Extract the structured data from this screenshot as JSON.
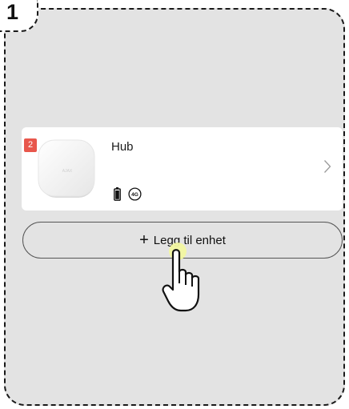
{
  "step": {
    "number": "1"
  },
  "hub_card": {
    "badge": "2",
    "device_name": "Hub",
    "device_logo_text": "AJAX",
    "network_label": "4G",
    "icons": {
      "battery": "battery-icon",
      "network": "network-4g-icon",
      "chevron": "chevron-right-icon"
    }
  },
  "add_button": {
    "plus": "+",
    "label": "Legg til enhet"
  },
  "pointer": {
    "icon": "hand-pointer-icon",
    "highlight_color": "#f2f7a0"
  },
  "colors": {
    "frame_background": "#e3e3e3",
    "badge": "#e8574c",
    "card": "#ffffff"
  }
}
